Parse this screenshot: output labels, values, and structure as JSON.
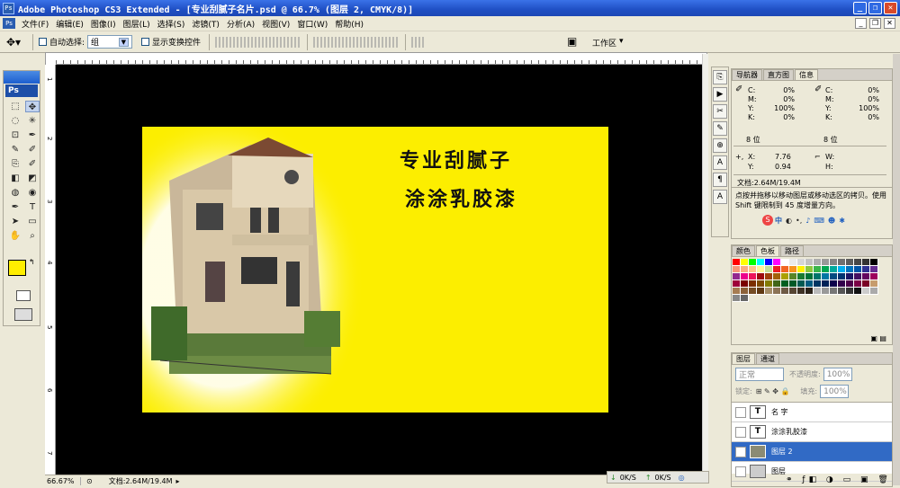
{
  "window": {
    "title": "Adobe Photoshop CS3 Extended - [专业刮腻子名片.psd @ 66.7% (图层 2, CMYK/8)]",
    "ps_label": "Ps"
  },
  "menu": [
    "文件(F)",
    "编辑(E)",
    "图像(I)",
    "图层(L)",
    "选择(S)",
    "滤镜(T)",
    "分析(A)",
    "视图(V)",
    "窗口(W)",
    "帮助(H)"
  ],
  "options": {
    "auto_select_label": "自动选择:",
    "auto_select_value": "组",
    "show_transform_label": "显示变换控件",
    "workspace_label": "工作区"
  },
  "toolbox": {
    "logo": "Ps",
    "tools": [
      "⬚",
      "✥",
      "◌",
      "✳",
      "⊡",
      "✒",
      "✎",
      "✐",
      "⎘",
      "✐",
      "◧",
      "◩",
      "◍",
      "◉",
      "✒",
      "T",
      "➤",
      "▭",
      "✋",
      "⌕"
    ],
    "fg_color": "#ffee00",
    "bg_color": "#ffffff"
  },
  "document": {
    "line1": "专业刮腻子",
    "line2": "涂涂乳胶漆",
    "bg_color": "#fcee00"
  },
  "ruler": [
    "1",
    "2",
    "3",
    "4",
    "5",
    "6",
    "7"
  ],
  "status": {
    "zoom": "66.67%",
    "doc": "文档:2.64M/19.4M"
  },
  "info_panel": {
    "tabs": [
      "导航器",
      "直方图",
      "信息"
    ],
    "left_channels": [
      [
        "C:",
        "0%"
      ],
      [
        "M:",
        "0%"
      ],
      [
        "Y:",
        "100%"
      ],
      [
        "K:",
        "0%"
      ]
    ],
    "right_channels": [
      [
        "C:",
        "0%"
      ],
      [
        "M:",
        "0%"
      ],
      [
        "Y:",
        "100%"
      ],
      [
        "K:",
        "0%"
      ]
    ],
    "left_bits": "8 位",
    "right_bits": "8 位",
    "x_label": "X:",
    "x_value": "7.76",
    "y_label": "Y:",
    "y_value": "0.94",
    "w_label": "W:",
    "h_label": "H:",
    "doc_size": "文档:2.64M/19.4M",
    "hint": "点按并拖移以移动图层或移动选区的拷贝。使用 Shift 键限制到 45 度增量方向。"
  },
  "ime": {
    "s_label": "S",
    "zh_label": "中"
  },
  "swatch_panel": {
    "tabs": [
      "颜色",
      "色板",
      "路径"
    ]
  },
  "layers_panel": {
    "tabs": [
      "图层",
      "通道"
    ],
    "blend_mode": "正常",
    "opacity_label": "不透明度:",
    "opacity": "100%",
    "lock_label": "锁定:",
    "fill_label": "填充:",
    "fill": "100%",
    "layers": [
      {
        "name": "名 字",
        "type": "text"
      },
      {
        "name": "涂涂乳胶漆",
        "type": "text"
      },
      {
        "name": "图层 2",
        "type": "image"
      },
      {
        "name": "图层",
        "type": "image"
      }
    ]
  },
  "transfer": {
    "down": "0K/S",
    "up": "0K/S"
  }
}
